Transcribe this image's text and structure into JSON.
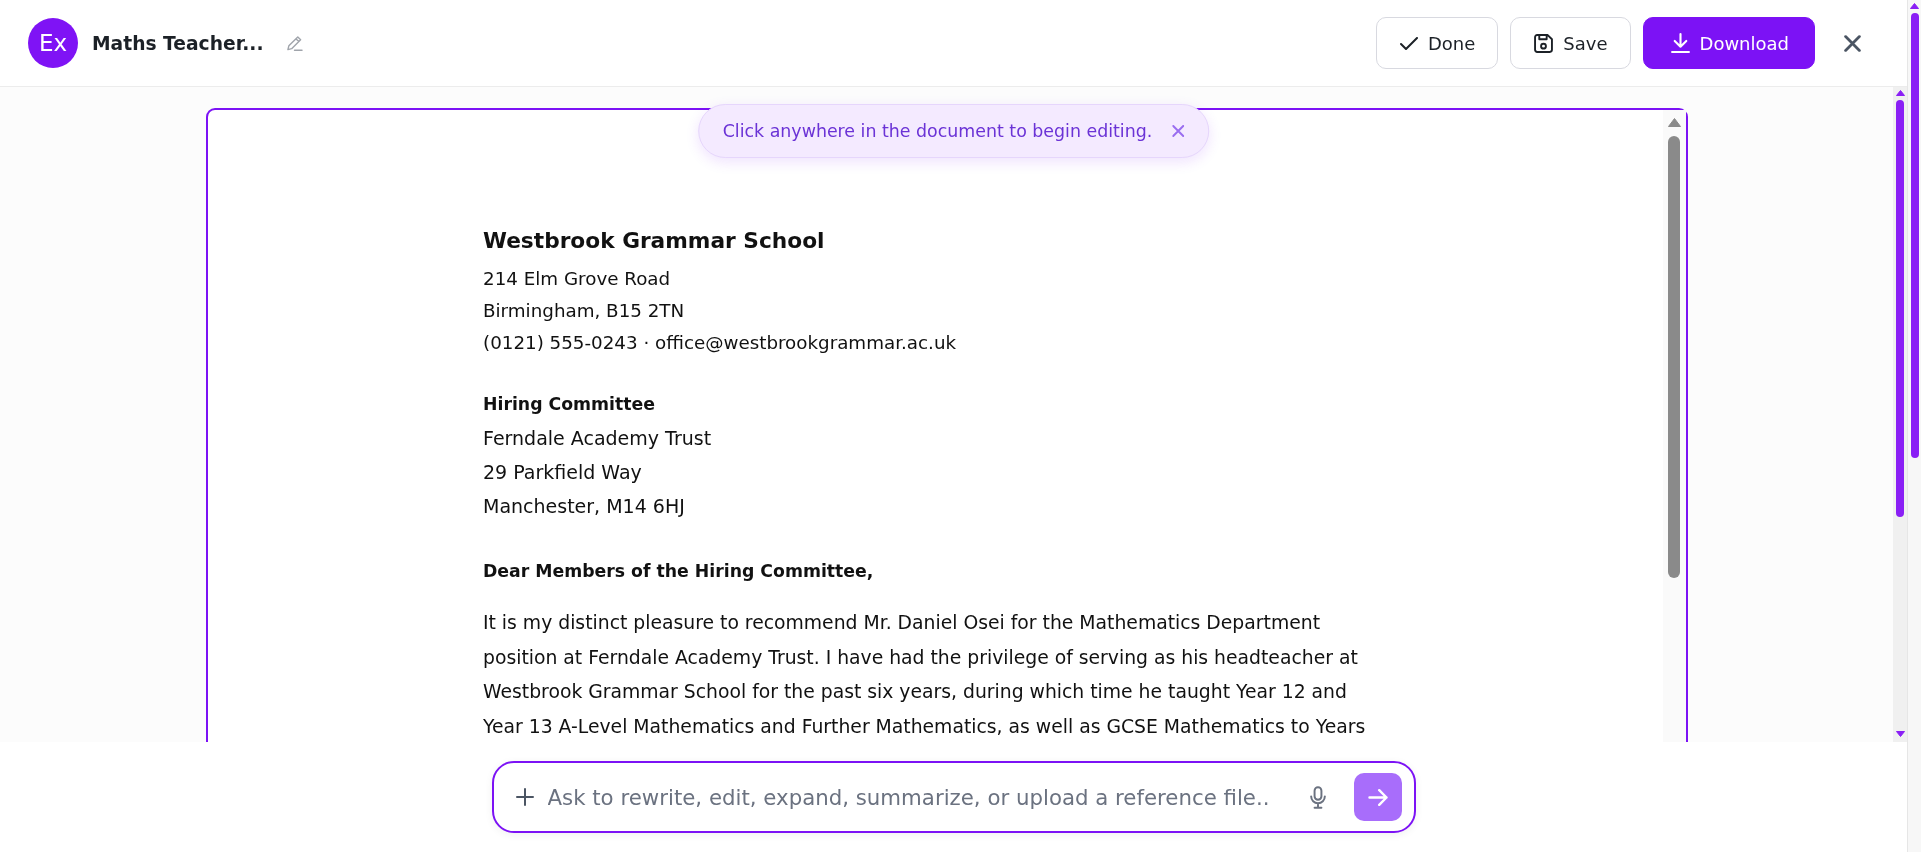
{
  "header": {
    "avatar": "Ex",
    "title": "Maths Teacher...",
    "buttons": [
      {
        "label": "Done",
        "kind": "check",
        "primary": false
      },
      {
        "label": "Save",
        "kind": "save",
        "primary": false
      },
      {
        "label": "Download",
        "kind": "download",
        "primary": true
      }
    ]
  },
  "notice": {
    "text": "Click anywhere in the document to begin editing."
  },
  "document": {
    "sender": {
      "name": "Westbrook Grammar School",
      "lines": [
        "214 Elm Grove Road",
        "Birmingham, B15 2TN",
        "(0121) 555-0243 · office@westbrookgrammar.ac.uk"
      ]
    },
    "recipient": {
      "name": "Hiring Committee",
      "lines": [
        "Ferndale Academy Trust",
        "29 Parkfield Way",
        "Manchester, M14 6HJ"
      ]
    },
    "salutation": "Dear Members of the Hiring Committee,",
    "paragraphs": [
      "It is my distinct pleasure to recommend Mr. Daniel Osei for the Mathematics Department position at Ferndale Academy Trust. I have had the privilege of serving as his headteacher at Westbrook Grammar School for the past six years, during which time he taught Year 12 and Year 13 A-Level Mathematics and Further Mathematics, as well as GCSE Mathematics to Years"
    ]
  },
  "composer": {
    "placeholder": "Ask to rewrite, edit, expand, summarize, or upload a reference file..",
    "send_disabled": true
  }
}
